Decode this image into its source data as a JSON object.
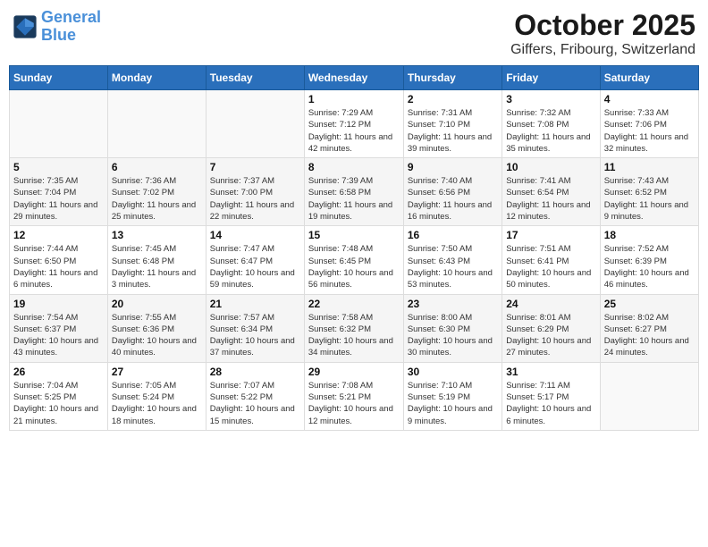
{
  "header": {
    "logo_line1": "General",
    "logo_line2": "Blue",
    "month": "October 2025",
    "location": "Giffers, Fribourg, Switzerland"
  },
  "weekdays": [
    "Sunday",
    "Monday",
    "Tuesday",
    "Wednesday",
    "Thursday",
    "Friday",
    "Saturday"
  ],
  "weeks": [
    [
      {
        "day": "",
        "sunrise": "",
        "sunset": "",
        "daylight": ""
      },
      {
        "day": "",
        "sunrise": "",
        "sunset": "",
        "daylight": ""
      },
      {
        "day": "",
        "sunrise": "",
        "sunset": "",
        "daylight": ""
      },
      {
        "day": "1",
        "sunrise": "Sunrise: 7:29 AM",
        "sunset": "Sunset: 7:12 PM",
        "daylight": "Daylight: 11 hours and 42 minutes."
      },
      {
        "day": "2",
        "sunrise": "Sunrise: 7:31 AM",
        "sunset": "Sunset: 7:10 PM",
        "daylight": "Daylight: 11 hours and 39 minutes."
      },
      {
        "day": "3",
        "sunrise": "Sunrise: 7:32 AM",
        "sunset": "Sunset: 7:08 PM",
        "daylight": "Daylight: 11 hours and 35 minutes."
      },
      {
        "day": "4",
        "sunrise": "Sunrise: 7:33 AM",
        "sunset": "Sunset: 7:06 PM",
        "daylight": "Daylight: 11 hours and 32 minutes."
      }
    ],
    [
      {
        "day": "5",
        "sunrise": "Sunrise: 7:35 AM",
        "sunset": "Sunset: 7:04 PM",
        "daylight": "Daylight: 11 hours and 29 minutes."
      },
      {
        "day": "6",
        "sunrise": "Sunrise: 7:36 AM",
        "sunset": "Sunset: 7:02 PM",
        "daylight": "Daylight: 11 hours and 25 minutes."
      },
      {
        "day": "7",
        "sunrise": "Sunrise: 7:37 AM",
        "sunset": "Sunset: 7:00 PM",
        "daylight": "Daylight: 11 hours and 22 minutes."
      },
      {
        "day": "8",
        "sunrise": "Sunrise: 7:39 AM",
        "sunset": "Sunset: 6:58 PM",
        "daylight": "Daylight: 11 hours and 19 minutes."
      },
      {
        "day": "9",
        "sunrise": "Sunrise: 7:40 AM",
        "sunset": "Sunset: 6:56 PM",
        "daylight": "Daylight: 11 hours and 16 minutes."
      },
      {
        "day": "10",
        "sunrise": "Sunrise: 7:41 AM",
        "sunset": "Sunset: 6:54 PM",
        "daylight": "Daylight: 11 hours and 12 minutes."
      },
      {
        "day": "11",
        "sunrise": "Sunrise: 7:43 AM",
        "sunset": "Sunset: 6:52 PM",
        "daylight": "Daylight: 11 hours and 9 minutes."
      }
    ],
    [
      {
        "day": "12",
        "sunrise": "Sunrise: 7:44 AM",
        "sunset": "Sunset: 6:50 PM",
        "daylight": "Daylight: 11 hours and 6 minutes."
      },
      {
        "day": "13",
        "sunrise": "Sunrise: 7:45 AM",
        "sunset": "Sunset: 6:48 PM",
        "daylight": "Daylight: 11 hours and 3 minutes."
      },
      {
        "day": "14",
        "sunrise": "Sunrise: 7:47 AM",
        "sunset": "Sunset: 6:47 PM",
        "daylight": "Daylight: 10 hours and 59 minutes."
      },
      {
        "day": "15",
        "sunrise": "Sunrise: 7:48 AM",
        "sunset": "Sunset: 6:45 PM",
        "daylight": "Daylight: 10 hours and 56 minutes."
      },
      {
        "day": "16",
        "sunrise": "Sunrise: 7:50 AM",
        "sunset": "Sunset: 6:43 PM",
        "daylight": "Daylight: 10 hours and 53 minutes."
      },
      {
        "day": "17",
        "sunrise": "Sunrise: 7:51 AM",
        "sunset": "Sunset: 6:41 PM",
        "daylight": "Daylight: 10 hours and 50 minutes."
      },
      {
        "day": "18",
        "sunrise": "Sunrise: 7:52 AM",
        "sunset": "Sunset: 6:39 PM",
        "daylight": "Daylight: 10 hours and 46 minutes."
      }
    ],
    [
      {
        "day": "19",
        "sunrise": "Sunrise: 7:54 AM",
        "sunset": "Sunset: 6:37 PM",
        "daylight": "Daylight: 10 hours and 43 minutes."
      },
      {
        "day": "20",
        "sunrise": "Sunrise: 7:55 AM",
        "sunset": "Sunset: 6:36 PM",
        "daylight": "Daylight: 10 hours and 40 minutes."
      },
      {
        "day": "21",
        "sunrise": "Sunrise: 7:57 AM",
        "sunset": "Sunset: 6:34 PM",
        "daylight": "Daylight: 10 hours and 37 minutes."
      },
      {
        "day": "22",
        "sunrise": "Sunrise: 7:58 AM",
        "sunset": "Sunset: 6:32 PM",
        "daylight": "Daylight: 10 hours and 34 minutes."
      },
      {
        "day": "23",
        "sunrise": "Sunrise: 8:00 AM",
        "sunset": "Sunset: 6:30 PM",
        "daylight": "Daylight: 10 hours and 30 minutes."
      },
      {
        "day": "24",
        "sunrise": "Sunrise: 8:01 AM",
        "sunset": "Sunset: 6:29 PM",
        "daylight": "Daylight: 10 hours and 27 minutes."
      },
      {
        "day": "25",
        "sunrise": "Sunrise: 8:02 AM",
        "sunset": "Sunset: 6:27 PM",
        "daylight": "Daylight: 10 hours and 24 minutes."
      }
    ],
    [
      {
        "day": "26",
        "sunrise": "Sunrise: 7:04 AM",
        "sunset": "Sunset: 5:25 PM",
        "daylight": "Daylight: 10 hours and 21 minutes."
      },
      {
        "day": "27",
        "sunrise": "Sunrise: 7:05 AM",
        "sunset": "Sunset: 5:24 PM",
        "daylight": "Daylight: 10 hours and 18 minutes."
      },
      {
        "day": "28",
        "sunrise": "Sunrise: 7:07 AM",
        "sunset": "Sunset: 5:22 PM",
        "daylight": "Daylight: 10 hours and 15 minutes."
      },
      {
        "day": "29",
        "sunrise": "Sunrise: 7:08 AM",
        "sunset": "Sunset: 5:21 PM",
        "daylight": "Daylight: 10 hours and 12 minutes."
      },
      {
        "day": "30",
        "sunrise": "Sunrise: 7:10 AM",
        "sunset": "Sunset: 5:19 PM",
        "daylight": "Daylight: 10 hours and 9 minutes."
      },
      {
        "day": "31",
        "sunrise": "Sunrise: 7:11 AM",
        "sunset": "Sunset: 5:17 PM",
        "daylight": "Daylight: 10 hours and 6 minutes."
      },
      {
        "day": "",
        "sunrise": "",
        "sunset": "",
        "daylight": ""
      }
    ]
  ]
}
